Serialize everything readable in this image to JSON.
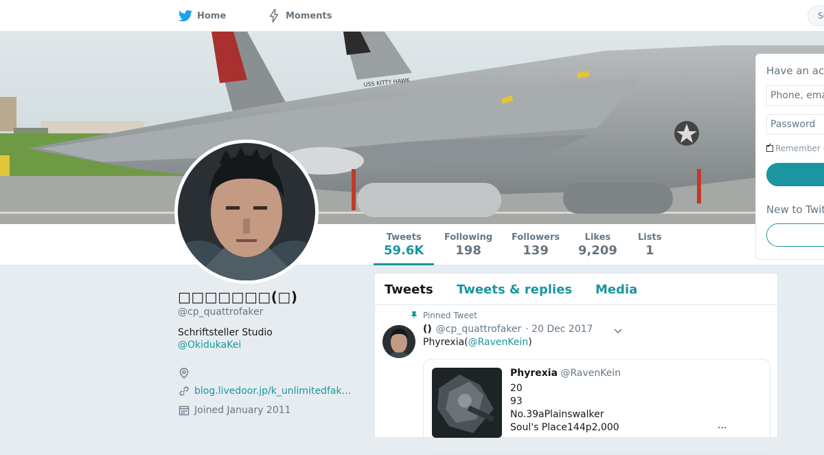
{
  "nav": {
    "home_label": "Home",
    "moments_label": "Moments",
    "search_placeholder": "Se"
  },
  "stats": [
    {
      "label": "Tweets",
      "value": "59.6K"
    },
    {
      "label": "Following",
      "value": "198"
    },
    {
      "label": "Followers",
      "value": "139"
    },
    {
      "label": "Likes",
      "value": "9,209"
    },
    {
      "label": "Lists",
      "value": "1"
    }
  ],
  "profile": {
    "name": "□□□□□□□(□)",
    "handle": "@cp_quattrofaker",
    "bio": "Schriftsteller Studio",
    "bio_mention": "@OkidukaKei",
    "website": "blog.livedoor.jp/k_unlimitedfak…",
    "joined": "Joined January 2011"
  },
  "timeline": {
    "tabs": [
      "Tweets",
      "Tweets & replies",
      "Media"
    ],
    "pinned_label": "Pinned Tweet",
    "tweet": {
      "name": "()",
      "handle": "@cp_quattrofaker",
      "date": "· 20 Dec 2017",
      "text_prefix": "Phyrexia(",
      "text_mention": "@RavenKein",
      "text_suffix": ")",
      "quote": {
        "name": "Phyrexia",
        "handle": "@RavenKein",
        "lines": [
          "20",
          "93",
          "No.39aPlainswalker",
          "Soul's Place144p2,000"
        ],
        "more": "..."
      }
    }
  },
  "login": {
    "title": "Have an acc",
    "phone_placeholder": "Phone, ema",
    "password_placeholder": "Password",
    "remember_label": "Remember r",
    "new_label": "New to Twitt"
  },
  "colors": {
    "accent": "#1b95a0",
    "twitter_blue": "#1da1f2",
    "background": "#e6ecf0"
  }
}
